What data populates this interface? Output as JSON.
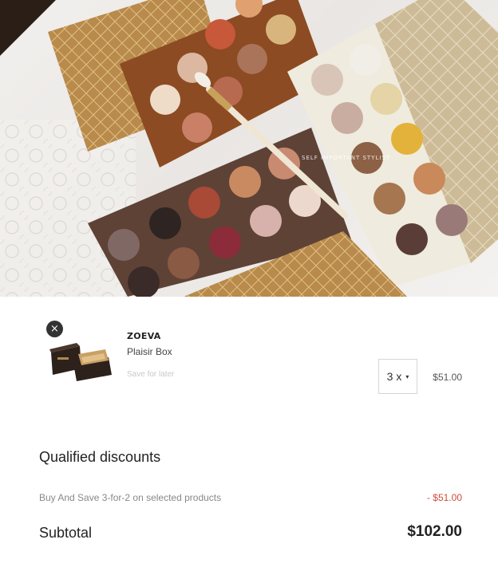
{
  "hero": {
    "watermark": "SELF IMPORTANT STYLIST"
  },
  "cart_item": {
    "remove_icon": "×",
    "brand": "ZOEVA",
    "name": "Plaisir Box",
    "save_for_later": "Save for later",
    "quantity": "3 x",
    "quantity_caret": "▾",
    "price": "$51.00"
  },
  "discounts": {
    "title": "Qualified discounts",
    "items": [
      {
        "name": "Buy And Save 3-for-2 on selected products",
        "amount": "- $51.00"
      }
    ]
  },
  "subtotal": {
    "label": "Subtotal",
    "value": "$102.00"
  },
  "colors": {
    "discount": "#d24a3a",
    "muted": "#c8c8c8",
    "text": "#222222"
  }
}
